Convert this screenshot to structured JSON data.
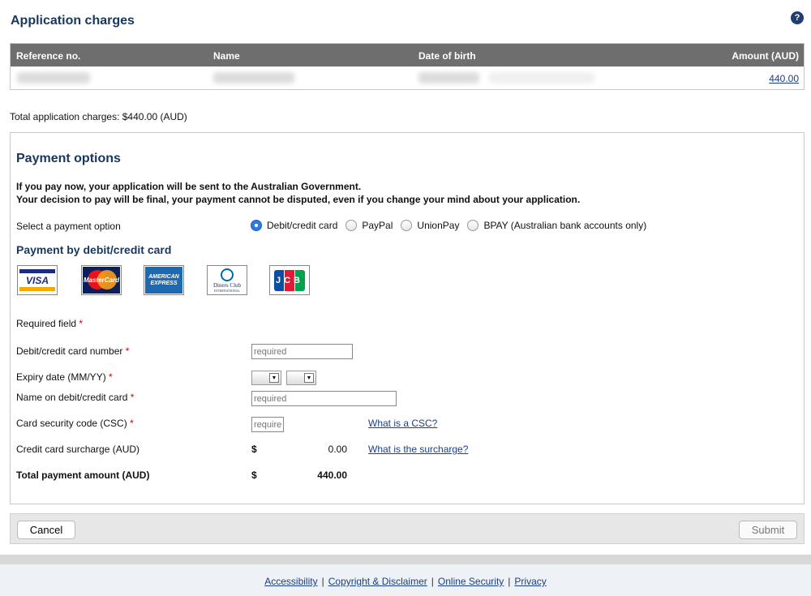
{
  "header": {
    "title": "Application charges",
    "help_icon": "?"
  },
  "charges_table": {
    "columns": {
      "reference": "Reference no.",
      "name": "Name",
      "dob": "Date of birth",
      "amount": "Amount (AUD)"
    },
    "row": {
      "amount": "440.00"
    }
  },
  "total_charges": "Total application charges: $440.00 (AUD)",
  "payment": {
    "title": "Payment options",
    "warning_line1": "If you pay now, your application will be sent to the Australian Government.",
    "warning_line2": "Your decision to pay will be final, your payment cannot be disputed, even if you change your mind about your application.",
    "select_label": "Select a payment option",
    "options": [
      "Debit/credit card",
      "PayPal",
      "UnionPay",
      "BPAY (Australian bank accounts only)"
    ],
    "selected_option": "Debit/credit card",
    "card_section_title": "Payment by debit/credit card",
    "cards": {
      "visa": "VISA",
      "mastercard": "MasterCard",
      "amex_line1": "AMERICAN",
      "amex_line2": "EXPRESS",
      "diners_line1": "Diners Club",
      "diners_line2": "INTERNATIONAL",
      "jcb": "JCB"
    },
    "required_field": "Required field",
    "required_mark": "*",
    "card_number_label": "Debit/credit card number",
    "card_number_placeholder": "required",
    "expiry_label": "Expiry date (MM/YY)",
    "name_label": "Name on debit/credit card",
    "name_placeholder": "required",
    "csc_label": "Card security code (CSC)",
    "csc_placeholder": "required",
    "csc_help": "What is a CSC?",
    "surcharge_label": "Credit card surcharge (AUD)",
    "surcharge_currency": "$",
    "surcharge_value": "0.00",
    "surcharge_help": "What is the surcharge?",
    "total_label": "Total payment amount (AUD)",
    "total_currency": "$",
    "total_value": "440.00"
  },
  "buttons": {
    "cancel": "Cancel",
    "submit": "Submit"
  },
  "footer": {
    "accessibility": "Accessibility",
    "copyright": "Copyright & Disclaimer",
    "security": "Online Security",
    "privacy": "Privacy",
    "separator": "|"
  },
  "colors": {
    "heading": "#17375e",
    "link": "#1a3f85",
    "table_header": "#6e6e6e",
    "required": "#cc0000"
  }
}
